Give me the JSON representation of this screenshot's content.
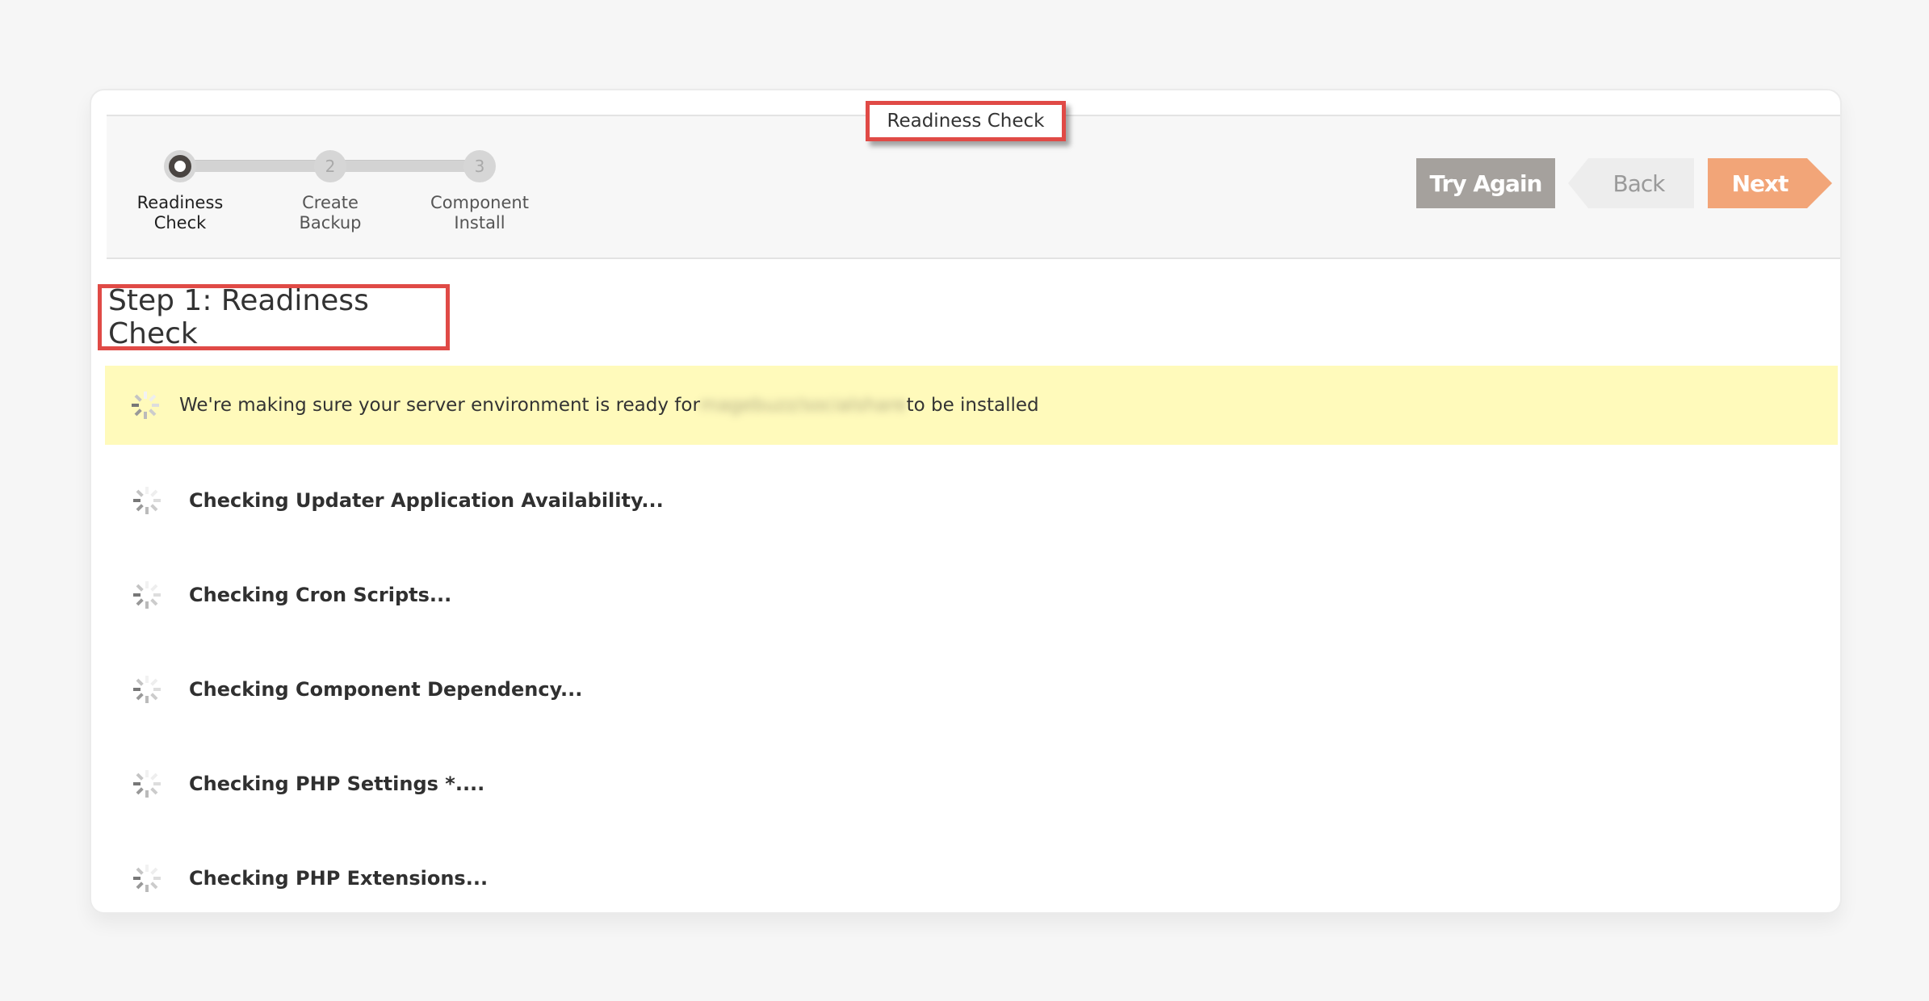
{
  "stepper": {
    "steps": [
      {
        "number": "1",
        "label_line1": "Readiness",
        "label_line2": "Check",
        "state": "active"
      },
      {
        "number": "2",
        "label_line1": "Create",
        "label_line2": "Backup",
        "state": "pending"
      },
      {
        "number": "3",
        "label_line1": "Component",
        "label_line2": "Install",
        "state": "pending"
      }
    ]
  },
  "tooltip": {
    "text": "Readiness Check"
  },
  "toolbar": {
    "try_again_label": "Try Again",
    "back_label": "Back",
    "next_label": "Next"
  },
  "page": {
    "heading": "Step 1: Readiness Check"
  },
  "banner": {
    "text_before": "We're making sure your server environment is ready for ",
    "package_name_blurred": "magebuzz/socialshare",
    "text_after": " to be installed"
  },
  "checks": [
    {
      "label": "Checking Updater Application Availability...",
      "status": "loading-icon"
    },
    {
      "label": "Checking Cron Scripts...",
      "status": "loading-icon"
    },
    {
      "label": "Checking Component Dependency...",
      "status": "loading-icon"
    },
    {
      "label": "Checking PHP Settings *....",
      "status": "loading-icon"
    },
    {
      "label": "Checking PHP Extensions...",
      "status": "loading-icon"
    }
  ],
  "colors": {
    "accent_next": "#f2a578",
    "try_again_bg": "#a5a19d",
    "back_bg": "#ededed",
    "banner_bg": "#fffabb",
    "highlight_border": "#e04a46"
  }
}
